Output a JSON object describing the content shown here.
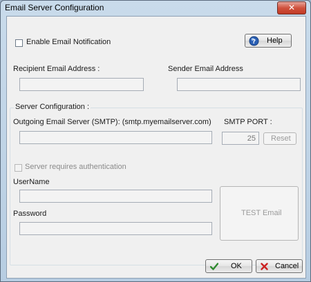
{
  "window": {
    "title": "Email Server Configuration",
    "close_glyph": "✕"
  },
  "enable_notification": {
    "label": "Enable Email Notification",
    "checked": false
  },
  "help_button": {
    "label": "Help",
    "icon": "help-icon"
  },
  "recipient": {
    "label": "Recipient Email Address :",
    "value": ""
  },
  "sender": {
    "label": "Sender Email Address",
    "value": ""
  },
  "server_config": {
    "group_label": "Server Configuration :",
    "smtp_server_label": "Outgoing Email Server (SMTP): (smtp.myemailserver.com)",
    "smtp_server_value": "",
    "smtp_port_label": "SMTP PORT :",
    "smtp_port_value": "25",
    "reset_label": "Reset",
    "auth_label": "Server requires authentication",
    "auth_checked": false,
    "username_label": "UserName",
    "username_value": "",
    "password_label": "Password",
    "password_value": "",
    "test_email_label": "TEST Email"
  },
  "ok_button": {
    "label": "OK",
    "icon": "check-icon",
    "color": "#2f8a2f"
  },
  "cancel_button": {
    "label": "Cancel",
    "icon": "cross-icon",
    "color": "#cc2222"
  }
}
